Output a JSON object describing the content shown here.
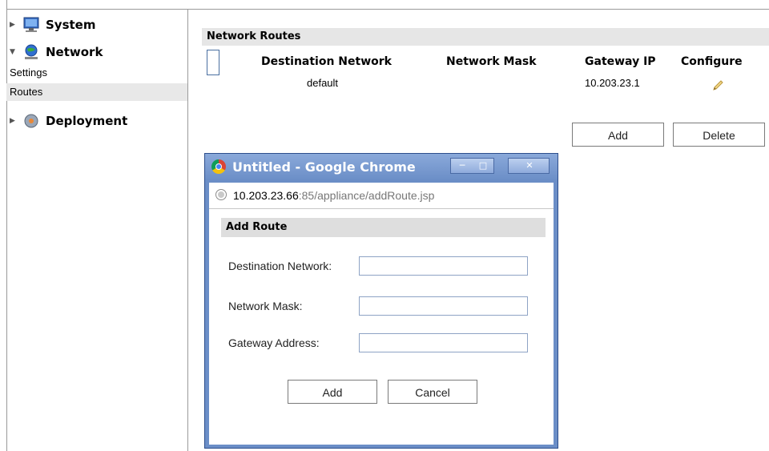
{
  "sidebar": {
    "nodes": [
      {
        "label": "System",
        "icon": "monitor-icon",
        "expanded": false
      },
      {
        "label": "Network",
        "icon": "network-globe-icon",
        "expanded": true,
        "children": [
          {
            "label": "Settings"
          },
          {
            "label": "Routes",
            "selected": true
          }
        ]
      },
      {
        "label": "Deployment",
        "icon": "deployment-gear-icon",
        "expanded": false
      }
    ]
  },
  "routes_panel": {
    "title": "Network Routes",
    "columns": [
      "Destination Network",
      "Network Mask",
      "Gateway IP",
      "Configure"
    ],
    "rows": [
      {
        "destination": "default",
        "mask": "",
        "gateway": "10.203.23.1",
        "configure_icon": "pencil-edit-icon"
      }
    ],
    "add_label": "Add",
    "delete_label": "Delete"
  },
  "popup": {
    "window_title": "Untitled - Google Chrome",
    "url_host": "10.203.23.66",
    "url_rest": ":85/appliance/addRoute.jsp",
    "form_title": "Add Route",
    "fields": [
      {
        "label": "Destination Network:",
        "value": ""
      },
      {
        "label": "Network Mask:",
        "value": ""
      },
      {
        "label": "Gateway Address:",
        "value": ""
      }
    ],
    "add_label": "Add",
    "cancel_label": "Cancel"
  },
  "colors": {
    "chrome_frame": "#6b8ec7",
    "header_gray": "#e6e6e6",
    "selected_row": "#e8e8e8"
  }
}
